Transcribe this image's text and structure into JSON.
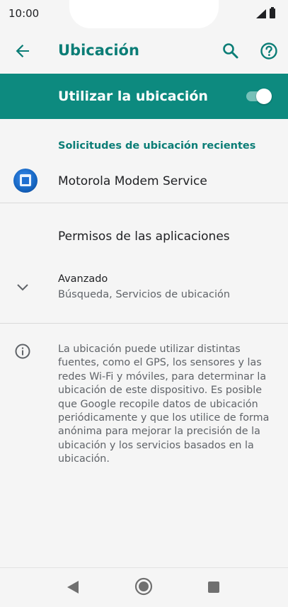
{
  "status_bar": {
    "time": "10:00"
  },
  "app_bar": {
    "title": "Ubicación",
    "icons": [
      "arrow-back-icon",
      "search-icon",
      "help-icon"
    ]
  },
  "master_switch": {
    "label": "Utilizar la ubicación",
    "state": "on"
  },
  "recent_requests": {
    "header": "Solicitudes de ubicación recientes",
    "items": [
      {
        "label": "Motorola Modem Service"
      }
    ]
  },
  "app_permissions": {
    "label": "Permisos de las aplicaciones"
  },
  "advanced": {
    "title": "Avanzado",
    "subtitle": "Búsqueda, Servicios de ubicación"
  },
  "info": {
    "text": "La ubicación puede utilizar distintas fuentes, como el GPS, los sensores y las redes Wi-Fi y móviles, para determinar la ubicación de este dispositivo. Es posible que Google recopile datos de ubicación periódicamente y que los utilice de forma anónima para mejorar la precisión de la ubicación y los servicios basados en la ubicación."
  },
  "colors": {
    "accent": "#0b7d76",
    "master_bg": "#0d8a7f",
    "background": "#f5f5f5"
  }
}
